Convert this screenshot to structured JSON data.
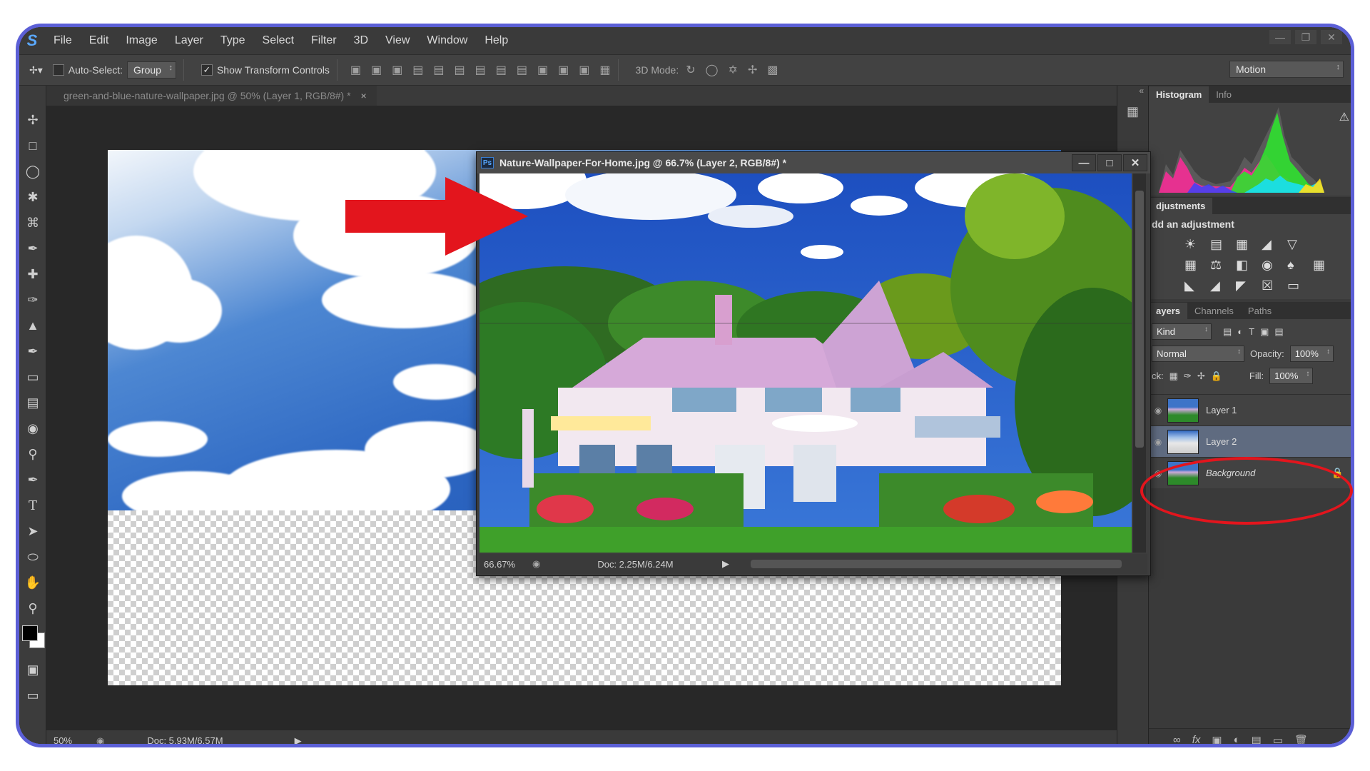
{
  "menu": {
    "logo": "S",
    "items": [
      "File",
      "Edit",
      "Image",
      "Layer",
      "Type",
      "Select",
      "Filter",
      "3D",
      "View",
      "Window",
      "Help"
    ]
  },
  "options": {
    "auto_select_label": "Auto-Select:",
    "group_value": "Group",
    "show_transform_label": "Show Transform Controls",
    "mode_3d_label": "3D Mode:",
    "workspace_value": "Motion"
  },
  "document": {
    "tab_title": "green-and-blue-nature-wallpaper.jpg @ 50% (Layer 1, RGB/8#) *",
    "tab_close": "×",
    "zoom": "50%",
    "doc_size": "Doc: 5.93M/6.57M"
  },
  "floating_window": {
    "badge": "Ps",
    "title": "Nature-Wallpaper-For-Home.jpg @ 66.7% (Layer 2, RGB/8#) *",
    "zoom": "66.67%",
    "doc_size": "Doc: 2.25M/6.24M"
  },
  "panels": {
    "top_tabs": [
      "Histogram",
      "Info"
    ],
    "adjustments_tab": "djustments",
    "adjustments_title": "dd an adjustment",
    "layers_tabs": [
      "ayers",
      "Channels",
      "Paths"
    ],
    "kind_value": "Kind",
    "blend_mode": "Normal",
    "opacity_label": "Opacity:",
    "opacity_value": "100%",
    "lock_label": "ck:",
    "fill_label": "Fill:",
    "fill_value": "100%",
    "layers": [
      {
        "name": "Layer 1",
        "selected": false
      },
      {
        "name": "Layer 2",
        "selected": true
      },
      {
        "name": "Background",
        "selected": false,
        "locked": true
      }
    ]
  },
  "colors": {
    "frame_border": "#5b5fd6",
    "annotation_red": "#e3151d",
    "selected_layer": "#5f6b80"
  }
}
